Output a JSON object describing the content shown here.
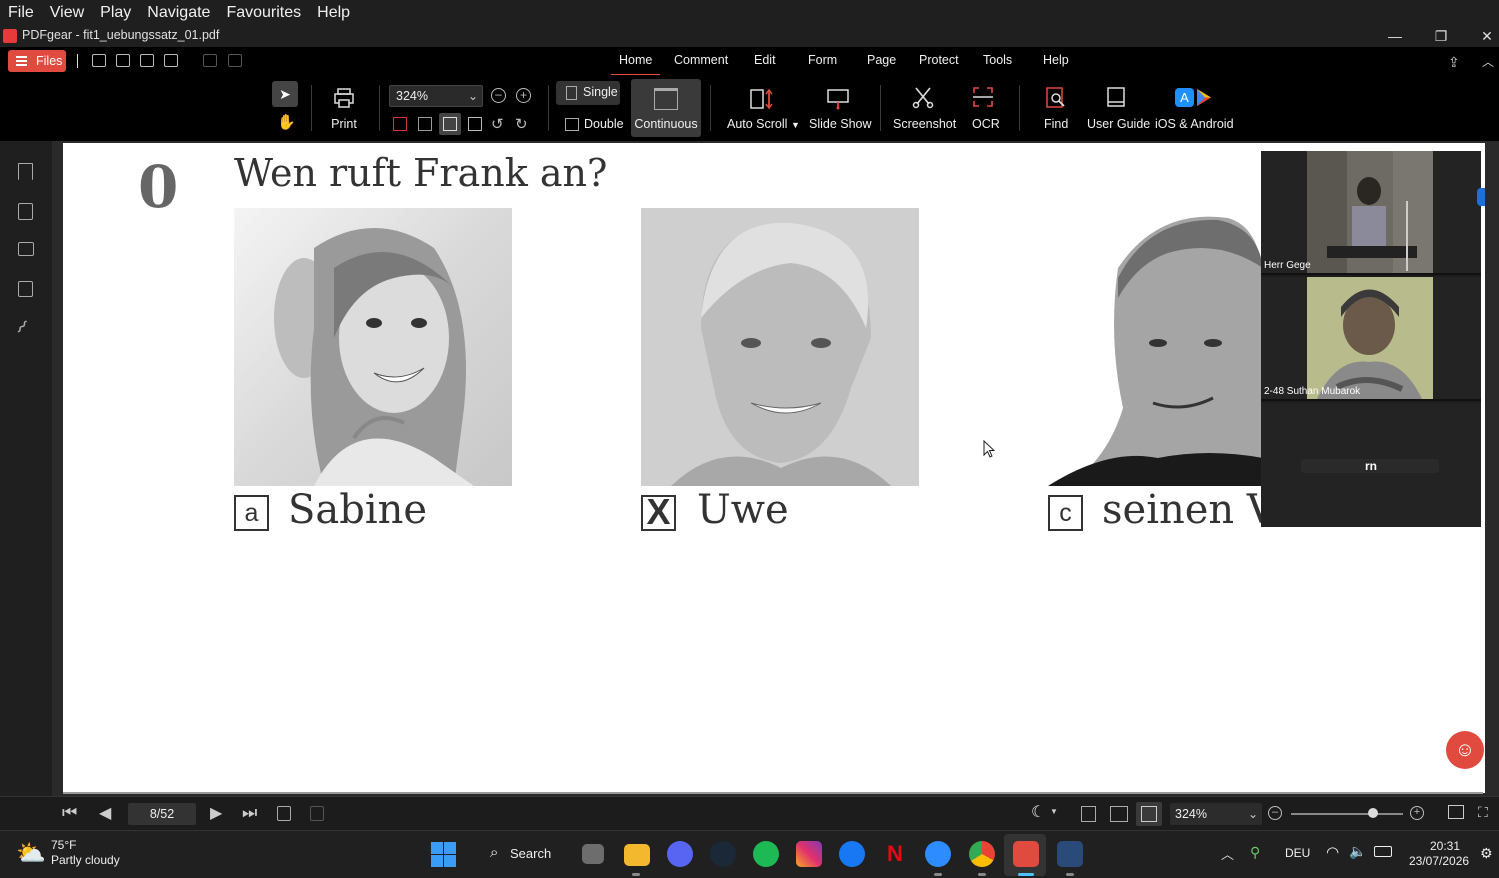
{
  "menu": [
    "File",
    "View",
    "Play",
    "Navigate",
    "Favourites",
    "Help"
  ],
  "window": {
    "title": "PDFgear - fit1_uebungssatz_01.pdf",
    "minimize": "—",
    "maximize": "❐",
    "close": "✕"
  },
  "files_button": "Files",
  "tabs": [
    "Home",
    "Comment",
    "Edit",
    "Form",
    "Page",
    "Protect",
    "Tools",
    "Help"
  ],
  "active_tab": "Home",
  "ribbon": {
    "print": "Print",
    "zoom": "324%",
    "single": "Single",
    "double": "Double",
    "continuous": "Continuous",
    "auto_scroll": "Auto Scroll",
    "slide_show": "Slide Show",
    "screenshot": "Screenshot",
    "ocr": "OCR",
    "find": "Find",
    "user_guide": "User Guide",
    "ios_android": "iOS & Android"
  },
  "document": {
    "number": "0",
    "question": "Wen ruft Frank an?",
    "options": [
      {
        "letter": "a",
        "text": "Sabine"
      },
      {
        "letter": "X",
        "text": "Uwe"
      },
      {
        "letter": "c",
        "text": "seinen Vat"
      }
    ]
  },
  "video_panel": {
    "participants": [
      "Herr Gege",
      "2-48 Suthan Mubarok",
      "rn"
    ]
  },
  "status": {
    "page": "8/52",
    "zoom": "324%"
  },
  "taskbar": {
    "weather_temp": "75°F",
    "weather_desc": "Partly cloudy",
    "search": "Search",
    "language": "DEU",
    "time": "20:31",
    "date": "23/07/2026"
  }
}
